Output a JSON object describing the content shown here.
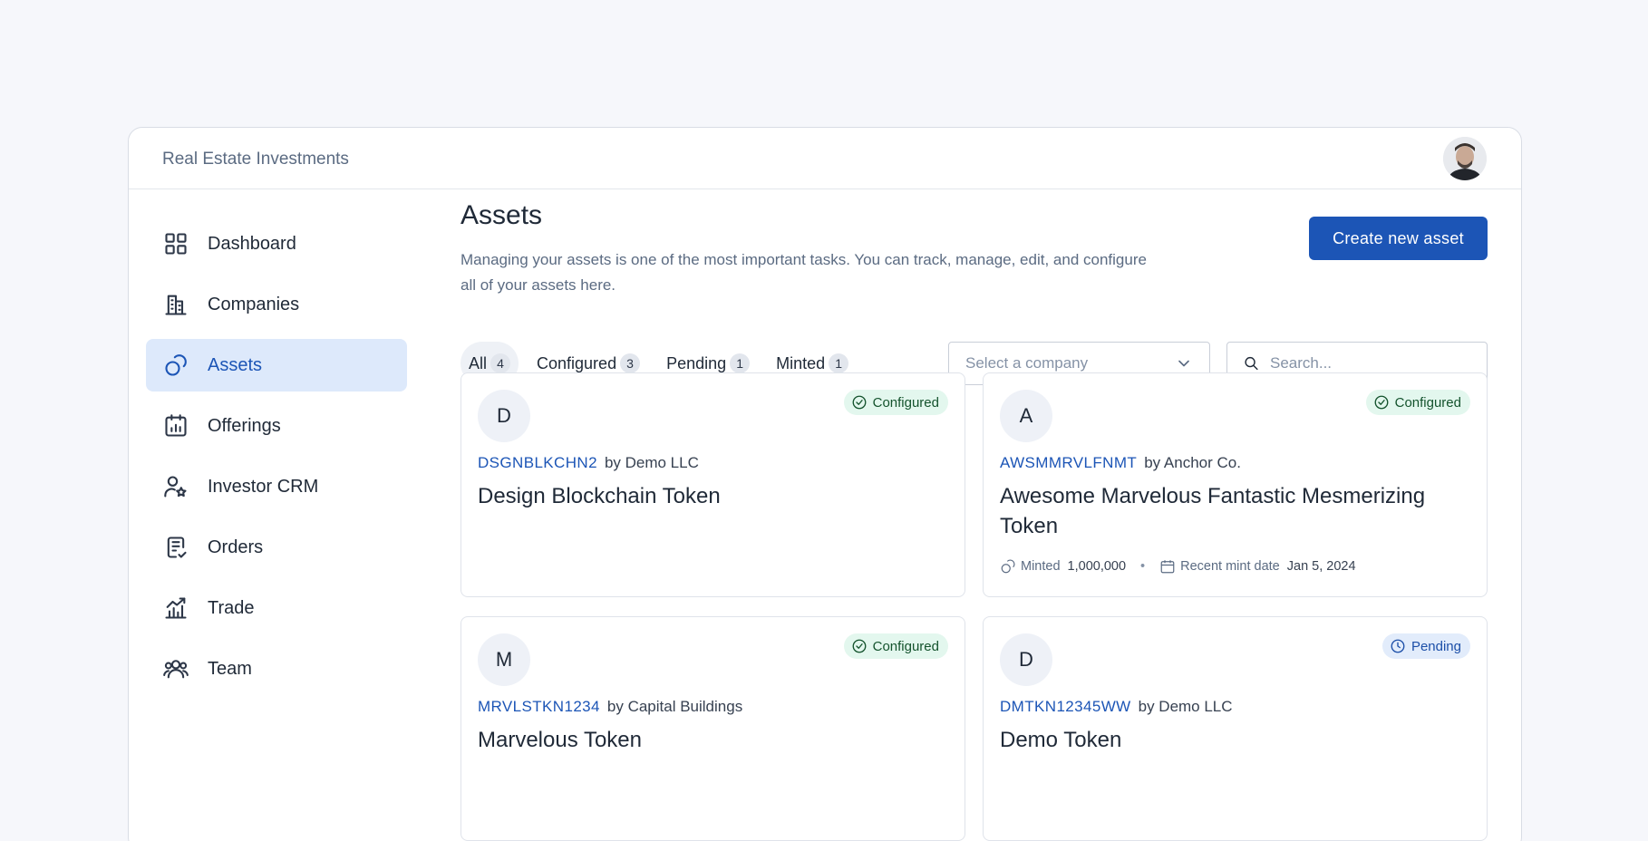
{
  "header": {
    "org_name": "Real Estate Investments",
    "avatar_alt": "user avatar"
  },
  "sidebar": {
    "items": [
      {
        "label": "Dashboard",
        "icon": "grid-icon",
        "active": false
      },
      {
        "label": "Companies",
        "icon": "building-icon",
        "active": false
      },
      {
        "label": "Assets",
        "icon": "coins-icon",
        "active": true
      },
      {
        "label": "Offerings",
        "icon": "calendar-chart-icon",
        "active": false
      },
      {
        "label": "Investor CRM",
        "icon": "user-star-icon",
        "active": false
      },
      {
        "label": "Orders",
        "icon": "receipt-check-icon",
        "active": false
      },
      {
        "label": "Trade",
        "icon": "chart-arrow-icon",
        "active": false
      },
      {
        "label": "Team",
        "icon": "users-icon",
        "active": false
      }
    ]
  },
  "main": {
    "title": "Assets",
    "description": "Managing your assets is one of the most important tasks. You can track, manage, edit, and configure all of your assets here.",
    "create_button_label": "Create new asset",
    "tabs": [
      {
        "label": "All",
        "count": "4",
        "active": true
      },
      {
        "label": "Configured",
        "count": "3",
        "active": false
      },
      {
        "label": "Pending",
        "count": "1",
        "active": false
      },
      {
        "label": "Minted",
        "count": "1",
        "active": false
      }
    ],
    "company_select": {
      "placeholder": "Select a company"
    },
    "search": {
      "placeholder": "Search...",
      "value": ""
    }
  },
  "assets": [
    {
      "initial": "D",
      "ticker": "DSGNBLKCHN2",
      "by": "by Demo LLC",
      "name": "Design Blockchain Token",
      "status": "Configured"
    },
    {
      "initial": "A",
      "ticker": "AWSMMRVLFNMT",
      "by": "by Anchor Co.",
      "name": "Awesome Marvelous Fantastic Mesmerizing Token",
      "status": "Configured",
      "meta": {
        "minted_label": "Minted",
        "minted_value": "1,000,000",
        "mint_date_label": "Recent mint date",
        "mint_date_value": "Jan 5, 2024"
      }
    },
    {
      "initial": "M",
      "ticker": "MRVLSTKN1234",
      "by": "by Capital Buildings",
      "name": "Marvelous Token",
      "status": "Configured"
    },
    {
      "initial": "D",
      "ticker": "DMTKN12345WW",
      "by": "by Demo LLC",
      "name": "Demo Token",
      "status": "Pending"
    }
  ],
  "colors": {
    "accent": "#1c55b6",
    "active_nav_bg": "#dde9fb",
    "configured_badge_bg": "#e3f7ee",
    "pending_badge_bg": "#e2ecfb"
  }
}
